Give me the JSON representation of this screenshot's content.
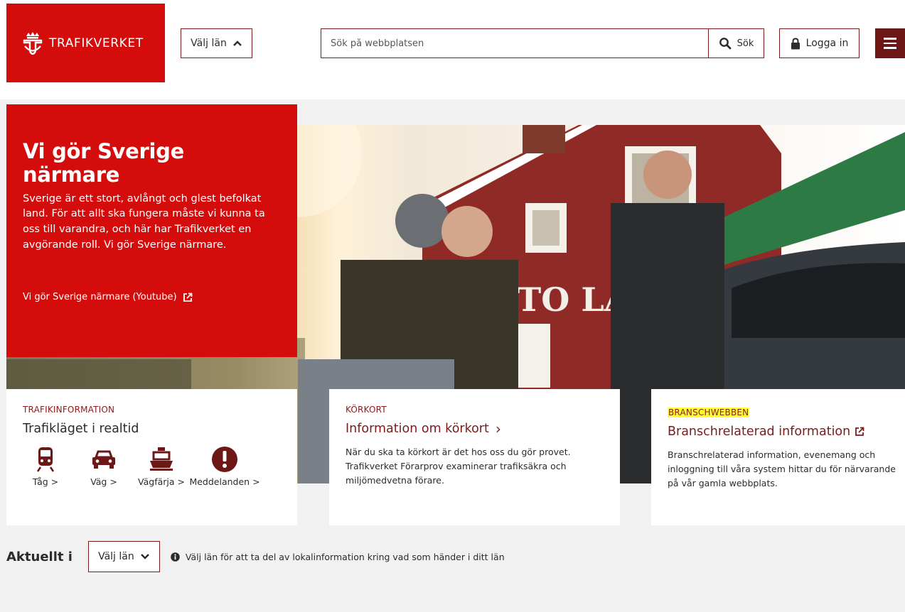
{
  "header": {
    "logo_text": "TRAFIKVERKET",
    "lan_button": "Välj län",
    "search_placeholder": "Sök på webbplatsen",
    "search_button": "Sök",
    "login_button": "Logga in"
  },
  "hero": {
    "title": "Vi gör Sverige närmare",
    "text": "Sverige är ett stort, avlångt och glest befolkat land. För att allt ska fungera måste vi kunna ta oss till varandra, och här har Trafikverket en avgörande roll. Vi gör Sverige närmare.",
    "link": "Vi gör Sverige närmare (Youtube)",
    "image_sign": "TO LA"
  },
  "cards": [
    {
      "kicker": "TRAFIKINFORMATION",
      "heading": "Trafikläget i realtid",
      "items": [
        {
          "label": "Tåg >",
          "icon": "train-icon"
        },
        {
          "label": "Väg >",
          "icon": "car-icon"
        },
        {
          "label": "Vägfärja >",
          "icon": "ferry-icon"
        },
        {
          "label": "Meddelanden >",
          "icon": "alert-icon"
        }
      ]
    },
    {
      "kicker": "KÖRKORT",
      "heading": "Information om körkort",
      "chevron": "›",
      "body": "När du ska ta körkort är det hos oss du gör provet. Trafikverket Förarprov examinerar trafiksäkra och miljömedvetna förare."
    },
    {
      "kicker": "BRANSCHWEBBEN",
      "heading": "Branschrelaterad information",
      "body_lines": [
        "Branschrelaterad information, evenemang och",
        "inloggning till våra system hittar du för närvarande",
        "på vår gamla webbplats."
      ]
    }
  ],
  "aktuellt": {
    "title": "Aktuellt i",
    "lan_button": "Välj län",
    "info": "Välj län för att ta del av lokalinformation kring vad som händer i ditt län"
  },
  "colors": {
    "brand_red": "#d50c0c",
    "dark_red": "#7a1c1c",
    "highlight": "#ffff33",
    "background": "#f1f1f1"
  }
}
